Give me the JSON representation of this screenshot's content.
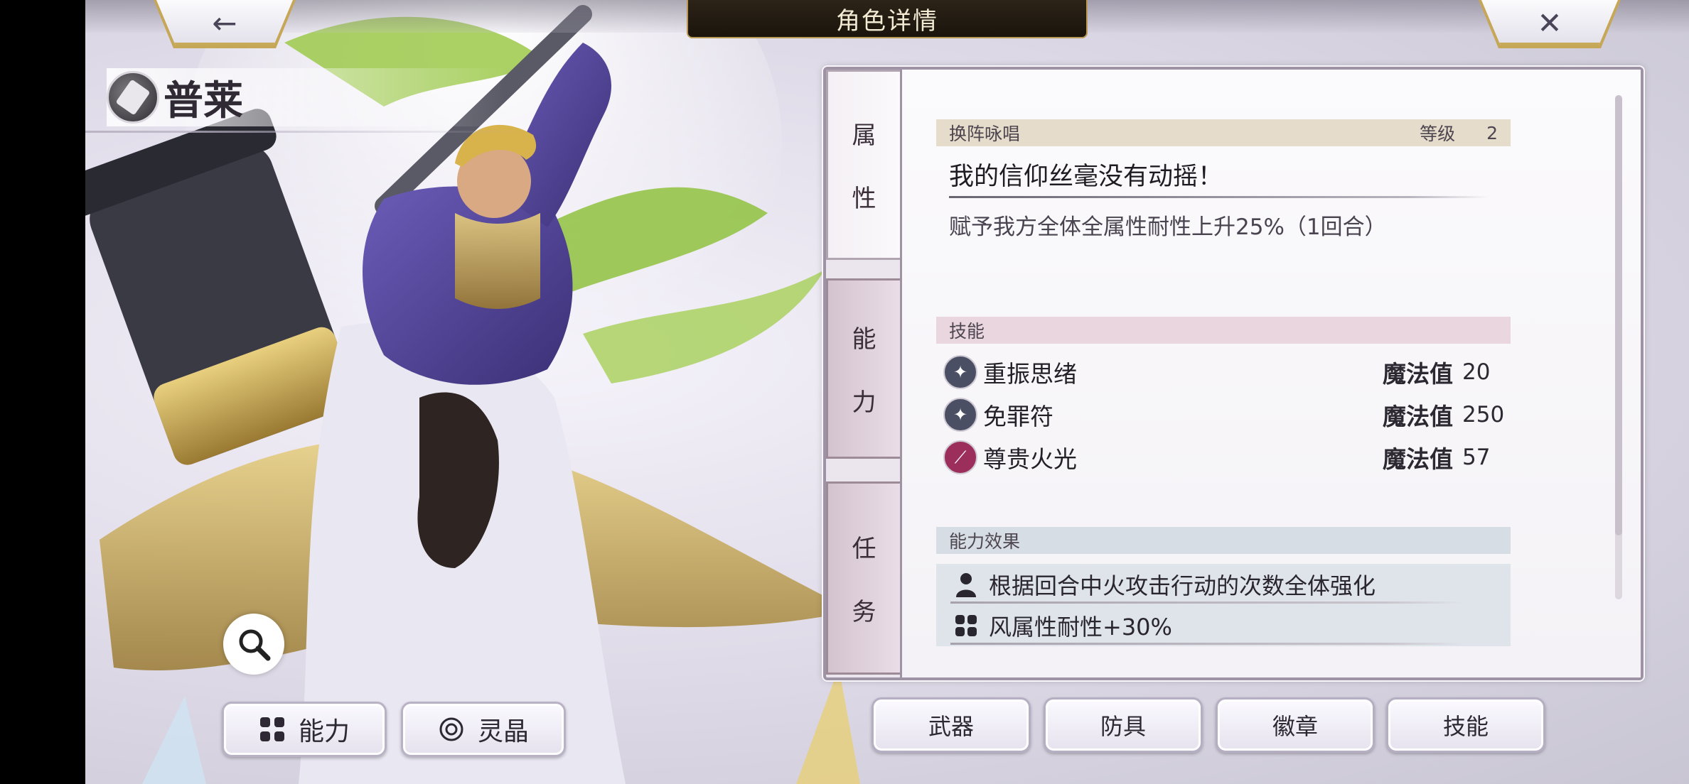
{
  "header": {
    "title": "角色详情",
    "back_icon": "←",
    "close_icon": "✕"
  },
  "character": {
    "name": "普莱",
    "weapon_type_icon": "hammer-icon"
  },
  "left_buttons": {
    "ability_label": "能力",
    "crystal_label": "灵晶"
  },
  "tabs": [
    {
      "label_top": "属",
      "label_bottom": "性",
      "active": true
    },
    {
      "label_top": "能",
      "label_bottom": "力",
      "active": false
    },
    {
      "label_top": "任",
      "label_bottom": "务",
      "active": false
    }
  ],
  "formation_chant": {
    "section_label": "换阵咏唱",
    "level_label": "等级",
    "level_value": "2",
    "skill_title": "我的信仰丝毫没有动摇！",
    "skill_desc": "赋予我方全体全属性耐性上升25%（1回合）"
  },
  "skills": {
    "section_label": "技能",
    "items": [
      {
        "name": "重振思绪",
        "mp_label": "魔法值",
        "mp": "20",
        "icon": "support-star-icon",
        "color": "#4b4f63"
      },
      {
        "name": "免罪符",
        "mp_label": "魔法值",
        "mp": "250",
        "icon": "support-star-icon",
        "color": "#4b4f63"
      },
      {
        "name": "尊贵火光",
        "mp_label": "魔法值",
        "mp": "57",
        "icon": "fire-slash-icon",
        "color": "#9c2e5c"
      }
    ]
  },
  "ability_effects": {
    "section_label": "能力效果",
    "items": [
      {
        "text": "根据回合中火攻击行动的次数全体强化",
        "icon": "person-icon"
      },
      {
        "text": "风属性耐性+30%",
        "icon": "grid-icon"
      }
    ]
  },
  "equip_buttons": [
    "武器",
    "防具",
    "徽章",
    "技能"
  ],
  "colors": {
    "chant_bar": "#e6dccb",
    "skill_bar": "#ead6de",
    "effect_bar": "#d6dde5",
    "gold": "#c6a657"
  }
}
